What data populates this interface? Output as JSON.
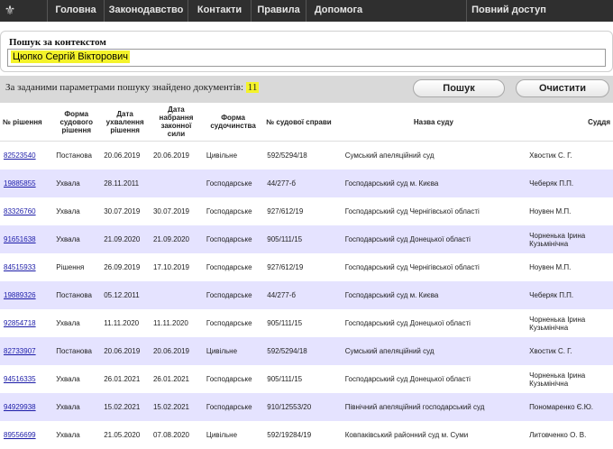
{
  "nav": {
    "items": [
      "Головна",
      "Законодавство",
      "Контакти",
      "Правила",
      "Допомога",
      "Повний доступ"
    ]
  },
  "search": {
    "label": "Пошук за контекстом",
    "value": "Цюпко Сергій Вікторович"
  },
  "results": {
    "text": "За заданими параметрами пошуку знайдено документів:",
    "count": "11",
    "search_button": "Пошук",
    "clear_button": "Очистити"
  },
  "table": {
    "headers": [
      "№ рішення",
      "Форма судового рішення",
      "Дата ухвалення рішення",
      "Дата набрання законної сили",
      "Форма судочинства",
      "№ судової справи",
      "Назва суду",
      "Суддя"
    ],
    "rows": [
      [
        "82523540",
        "Постанова",
        "20.06.2019",
        "20.06.2019",
        "Цивільне",
        "592/5294/18",
        "Сумський апеляційний суд",
        "Хвостик С. Г."
      ],
      [
        "19885855",
        "Ухвала",
        "28.11.2011",
        "",
        "Господарське",
        "44/277-б",
        "Господарський суд м. Києва",
        "Чеберяк П.П."
      ],
      [
        "83326760",
        "Ухвала",
        "30.07.2019",
        "30.07.2019",
        "Господарське",
        "927/612/19",
        "Господарський суд Чернігівської області",
        "Ноувен М.П."
      ],
      [
        "91651638",
        "Ухвала",
        "21.09.2020",
        "21.09.2020",
        "Господарське",
        "905/111/15",
        "Господарський суд Донецької області",
        "Чорненька Ірина Кузьмінічна"
      ],
      [
        "84515933",
        "Рішення",
        "26.09.2019",
        "17.10.2019",
        "Господарське",
        "927/612/19",
        "Господарський суд Чернігівської області",
        "Ноувен М.П."
      ],
      [
        "19889326",
        "Постанова",
        "05.12.2011",
        "",
        "Господарське",
        "44/277-б",
        "Господарський суд м. Києва",
        "Чеберяк П.П."
      ],
      [
        "92854718",
        "Ухвала",
        "11.11.2020",
        "11.11.2020",
        "Господарське",
        "905/111/15",
        "Господарський суд Донецької області",
        "Чорненька Ірина Кузьмінічна"
      ],
      [
        "82733907",
        "Постанова",
        "20.06.2019",
        "20.06.2019",
        "Цивільне",
        "592/5294/18",
        "Сумський апеляційний суд",
        "Хвостик С. Г."
      ],
      [
        "94516335",
        "Ухвала",
        "26.01.2021",
        "26.01.2021",
        "Господарське",
        "905/111/15",
        "Господарський суд Донецької області",
        "Чорненька Ірина Кузьмінічна"
      ],
      [
        "94929938",
        "Ухвала",
        "15.02.2021",
        "15.02.2021",
        "Господарське",
        "910/12553/20",
        "Північний апеляційний господарський суд",
        "Пономаренко Є.Ю."
      ],
      [
        "89556699",
        "Ухвала",
        "21.05.2020",
        "07.08.2020",
        "Цивільне",
        "592/19284/19",
        "Ковпаківський районний суд м. Суми",
        "Литовченко О. В."
      ]
    ]
  },
  "colors": {
    "nav_bg": "#2f2f2f",
    "highlight": "#f4f32a",
    "row_alt": "#e5e3ff",
    "link": "#1c1ca8"
  }
}
